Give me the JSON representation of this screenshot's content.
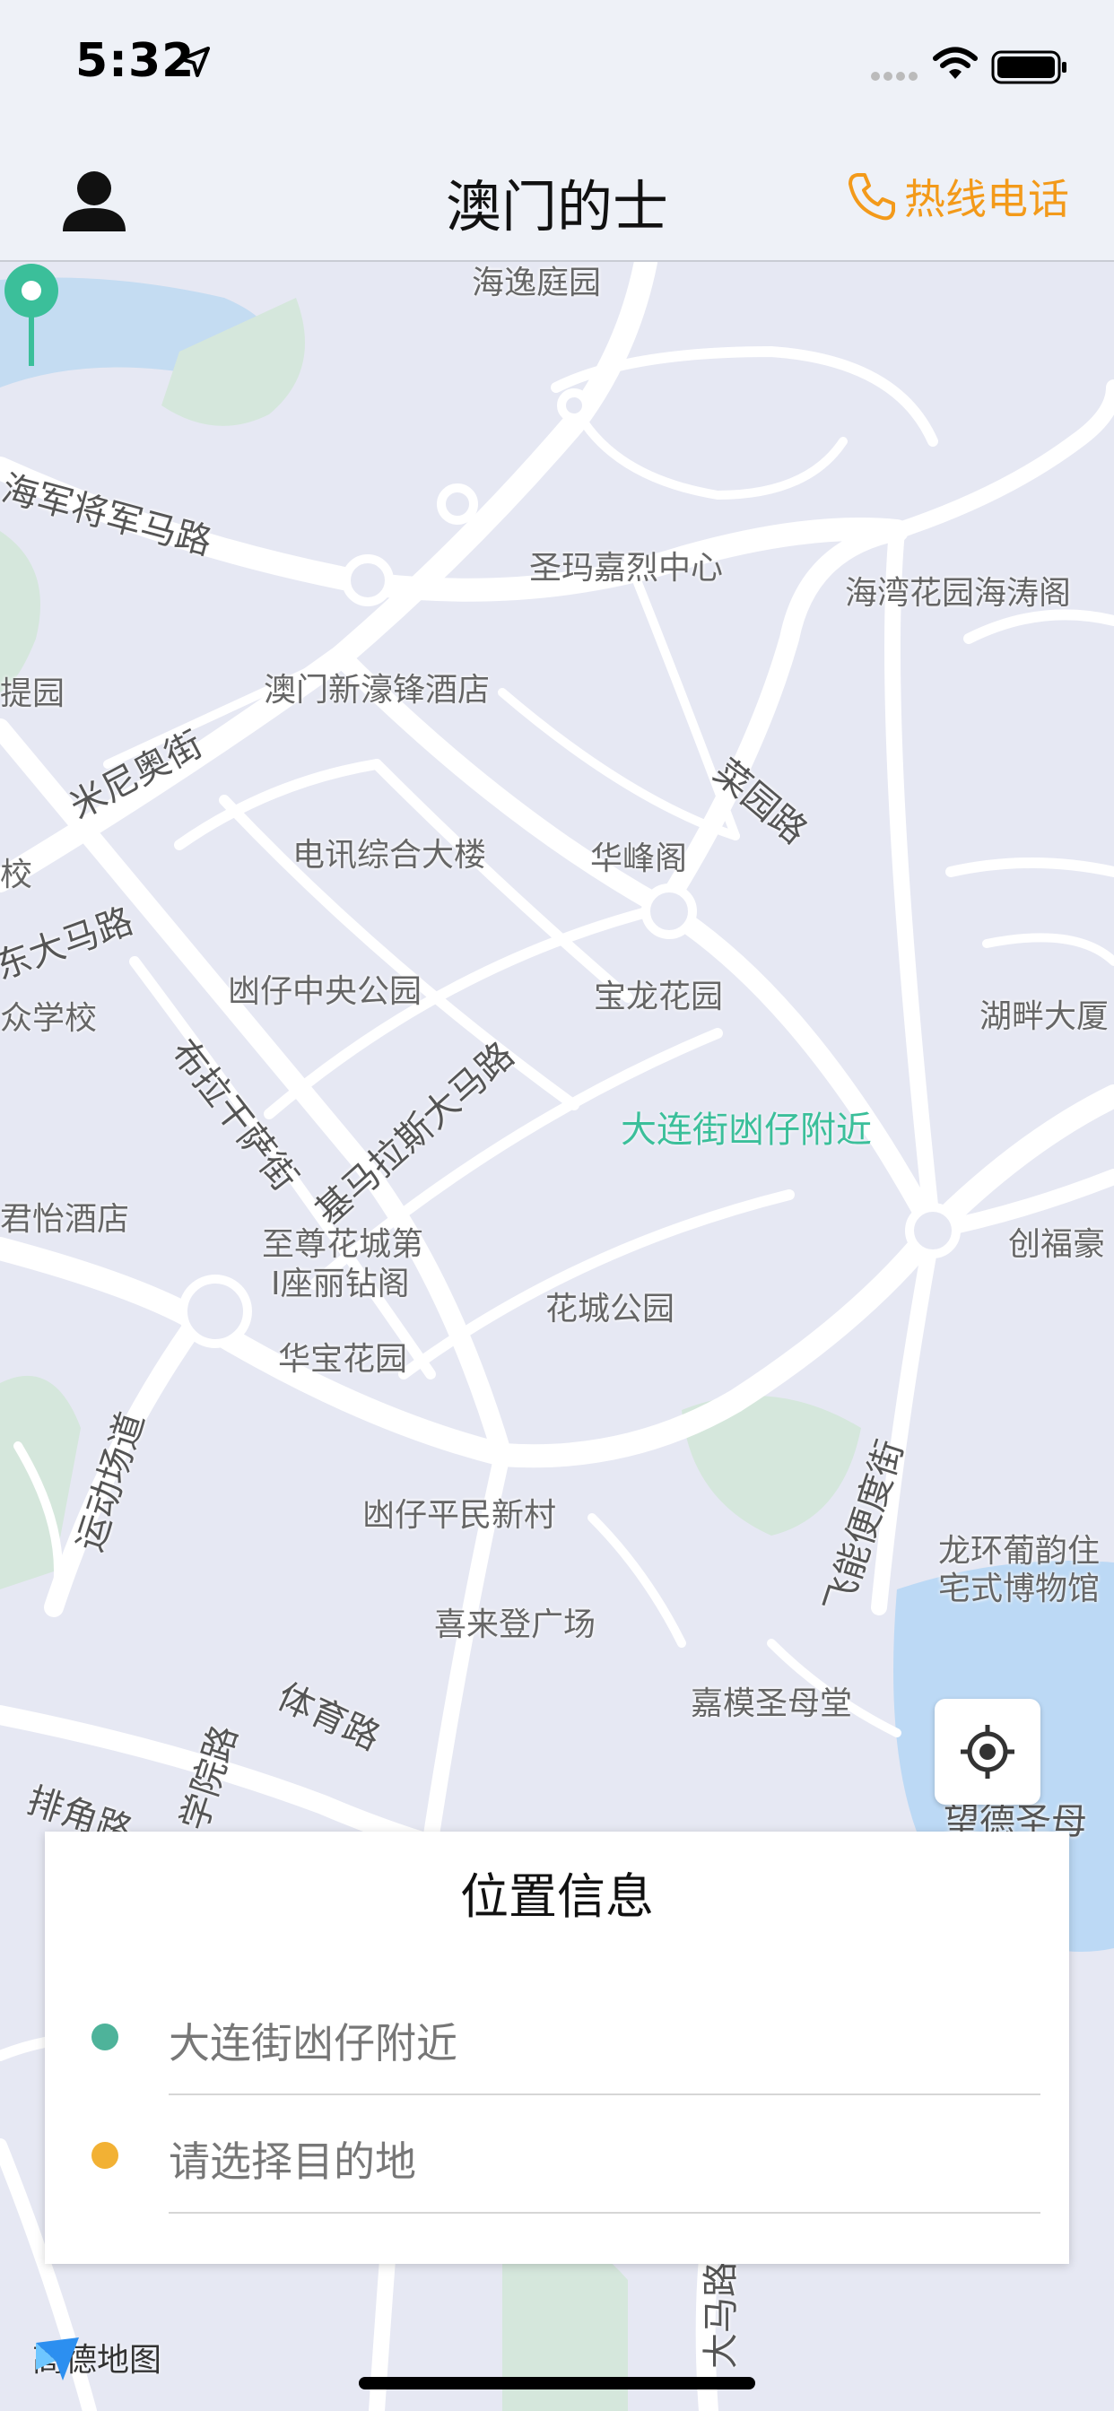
{
  "status_bar": {
    "time": "5:32"
  },
  "nav": {
    "title": "澳门的士",
    "hotline_label": "热线电话"
  },
  "map": {
    "labels": [
      "海逸庭园",
      "圣玛嘉烈中心",
      "海湾花园海涛阁",
      "澳门新濠锋酒店",
      "提园",
      "菜园路",
      "电讯综合大楼",
      "华峰阁",
      "校",
      "凼仔中央公园",
      "宝龙花园",
      "湖畔大厦",
      "众学校",
      "君怡酒店",
      "至尊花城第",
      "I座丽钻阁",
      "花城公园",
      "创福豪",
      "华宝花园",
      "凼仔平民新村",
      "龙环葡韵住",
      "宅式博物馆",
      "喜来登广场",
      "嘉模圣母堂",
      "望德圣母"
    ],
    "roads": [
      "海军将军马路",
      "米尼奥街",
      "东大马路",
      "布拉干萨街",
      "基马拉斯大马路",
      "运动场道",
      "飞能便度街",
      "体育路",
      "学院路",
      "排角路",
      "大马路"
    ],
    "pin_label": "大连街凼仔附近",
    "logo_text": "高德地图",
    "colors": {
      "pin": "#3bbf9a",
      "water": "#bcd9f5",
      "green": "#d4e8de"
    }
  },
  "panel": {
    "title": "位置信息",
    "origin": {
      "text": "大连街凼仔附近",
      "color": "#4eb39a"
    },
    "destination": {
      "placeholder": "请选择目的地",
      "color": "#f2b134"
    }
  }
}
